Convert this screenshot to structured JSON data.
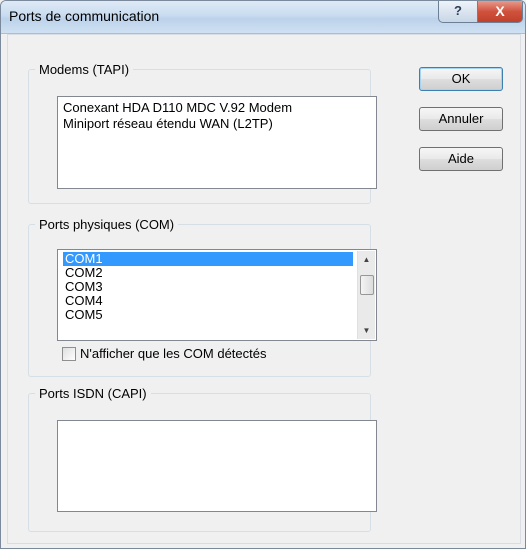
{
  "window": {
    "title": "Ports de communication",
    "help_glyph": "?",
    "close_glyph": "X"
  },
  "modems": {
    "legend": "Modems (TAPI)",
    "items": [
      "Conexant HDA D110 MDC V.92 Modem",
      "Miniport réseau étendu WAN (L2TP)"
    ]
  },
  "com": {
    "legend": "Ports physiques (COM)",
    "items": [
      "COM1",
      "COM2",
      "COM3",
      "COM4",
      "COM5"
    ],
    "selected": "COM1",
    "checkbox_label": "N'afficher que les COM détectés",
    "checkbox_checked": false
  },
  "isdn": {
    "legend": "Ports ISDN (CAPI)",
    "items": []
  },
  "buttons": {
    "ok": "OK",
    "cancel": "Annuler",
    "help": "Aide"
  },
  "colors": {
    "selection": "#3399ff",
    "close_button": "#c0402b"
  }
}
